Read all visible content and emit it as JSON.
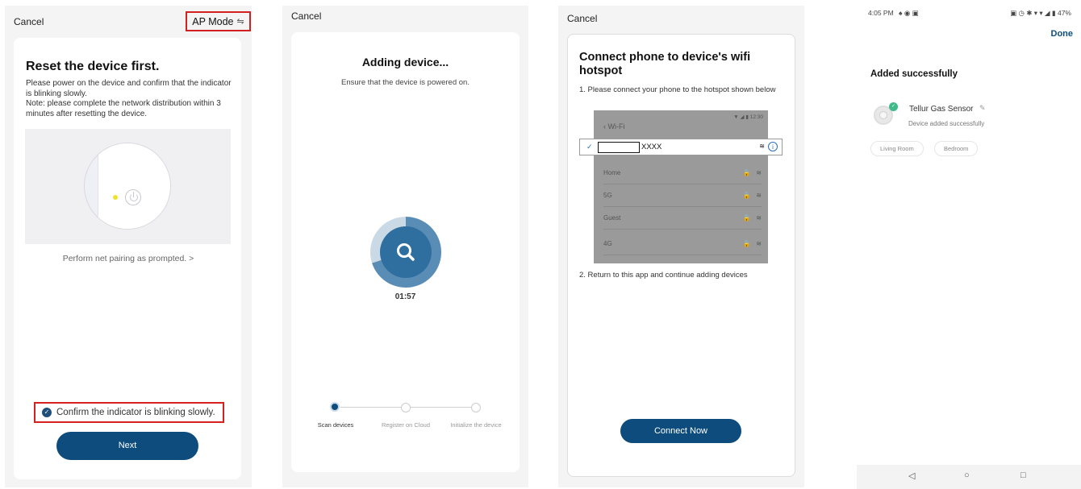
{
  "screen1": {
    "cancel": "Cancel",
    "ap_mode": "AP Mode",
    "ap_switch_icon": "⇋",
    "title": "Reset the device first.",
    "desc": "Please power on the device and confirm that the indicator is blinking slowly.\nNote: please complete the network distribution within 3 minutes after resetting the device.",
    "pair_prompt": "Perform net pairing as prompted. >",
    "confirm": "Confirm the indicator is blinking slowly.",
    "next": "Next",
    "highlight_color": "#d32020"
  },
  "screen2": {
    "cancel": "Cancel",
    "title": "Adding device...",
    "subtitle": "Ensure that the device is powered on.",
    "timer": "01:57",
    "steps": [
      {
        "label": "Scan devices",
        "state": "active"
      },
      {
        "label": "Register on Cloud",
        "state": "pending"
      },
      {
        "label": "Initialize the device",
        "state": "pending"
      }
    ],
    "progress_fraction": 0.7,
    "accent_color": "#0d4c7c"
  },
  "screen3": {
    "cancel": "Cancel",
    "title": "Connect phone to device's wifi hotspot",
    "step1": "1. Please connect your phone to the hotspot shown below",
    "phone_status": "▼ ◢ ▮ 12:30",
    "wifi_back": "‹  Wi-Fi",
    "selected_network": "XXXX",
    "networks": [
      {
        "name": "Home"
      },
      {
        "name": "5G"
      },
      {
        "name": "Guest"
      },
      {
        "name": "4G"
      }
    ],
    "step2": "2. Return to this app and continue adding devices",
    "connect_now": "Connect Now"
  },
  "screen4": {
    "time": "4:05 PM",
    "status_icons_left": "♠ ◉ ▣",
    "status_icons_right": "▣ ◷ ✱ ▾ ▾ ◢ ▮ 47%",
    "done": "Done",
    "added": "Added successfully",
    "device_name": "Tellur Gas Sensor",
    "device_sub": "Device added successfully",
    "rooms": [
      "Living Room",
      "Bedroom"
    ],
    "nav": {
      "back": "◁",
      "home": "○",
      "recents": "□"
    }
  }
}
